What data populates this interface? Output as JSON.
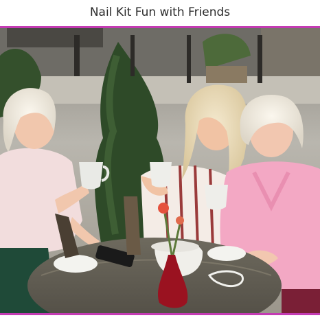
{
  "header": {
    "title": "Nail Kit Fun with Friends"
  },
  "photo": {
    "alt": "Four older women laughing together at an outdoor café table with coffee cups"
  },
  "colors": {
    "accent": "#c33bb3",
    "background": "#ffffff",
    "title_text": "#2b2b2b"
  }
}
